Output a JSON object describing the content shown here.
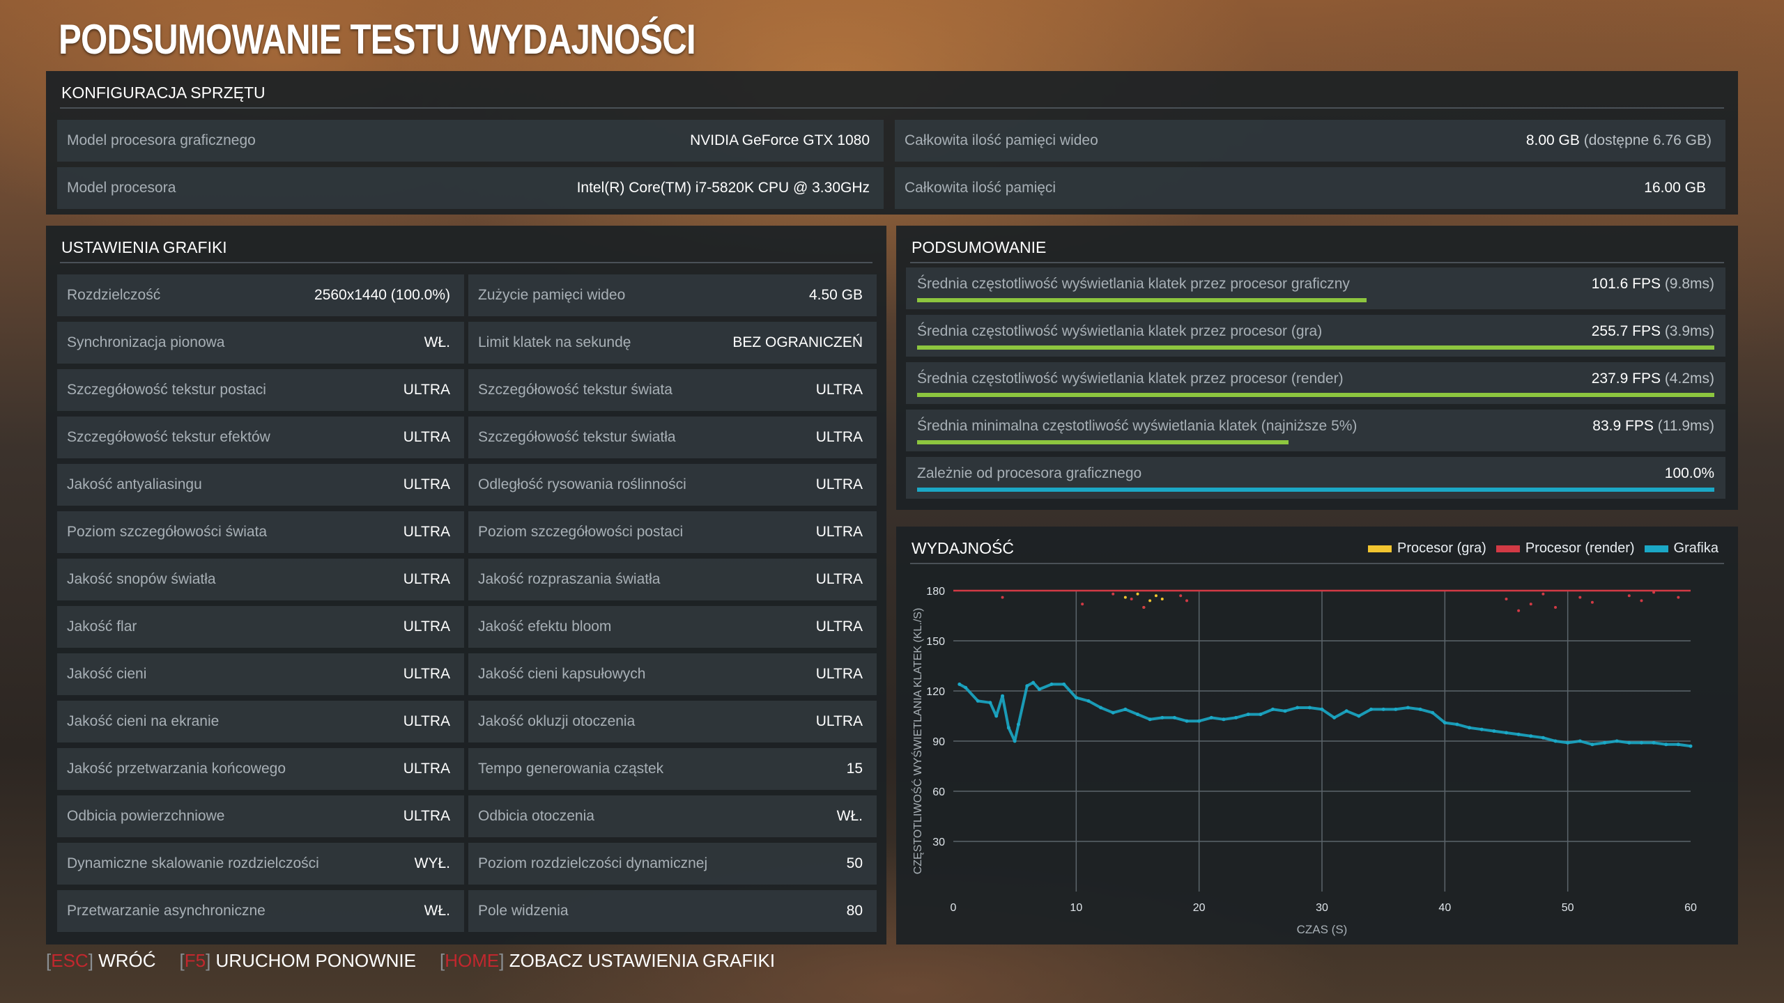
{
  "title": "PODSUMOWANIE TESTU WYDAJNOŚCI",
  "hardware": {
    "header": "KONFIGURACJA SPRZĘTU",
    "gpu_label": "Model procesora graficznego",
    "gpu_value": "NVIDIA GeForce GTX 1080",
    "cpu_label": "Model procesora",
    "cpu_value": "Intel(R) Core(TM) i7-5820K CPU @ 3.30GHz",
    "vram_label": "Całkowita ilość pamięci wideo",
    "vram_value": "8.00 GB",
    "vram_available": "(dostępne 6.76 GB)",
    "ram_label": "Całkowita ilość pamięci",
    "ram_value": "16.00 GB"
  },
  "graphics": {
    "header": "USTAWIENIA GRAFIKI",
    "left": [
      {
        "label": "Rozdzielczość",
        "value": "2560x1440 (100.0%)"
      },
      {
        "label": "Synchronizacja pionowa",
        "value": "WŁ."
      },
      {
        "label": "Szczegółowość tekstur postaci",
        "value": "ULTRA"
      },
      {
        "label": "Szczegółowość tekstur efektów",
        "value": "ULTRA"
      },
      {
        "label": "Jakość antyaliasingu",
        "value": "ULTRA"
      },
      {
        "label": "Poziom szczegółowości świata",
        "value": "ULTRA"
      },
      {
        "label": "Jakość snopów światła",
        "value": "ULTRA"
      },
      {
        "label": "Jakość flar",
        "value": "ULTRA"
      },
      {
        "label": "Jakość cieni",
        "value": "ULTRA"
      },
      {
        "label": "Jakość cieni na ekranie",
        "value": "ULTRA"
      },
      {
        "label": "Jakość przetwarzania końcowego",
        "value": "ULTRA"
      },
      {
        "label": "Odbicia powierzchniowe",
        "value": "ULTRA"
      },
      {
        "label": "Dynamiczne skalowanie rozdzielczości",
        "value": "WYŁ."
      },
      {
        "label": "Przetwarzanie asynchroniczne",
        "value": "WŁ."
      }
    ],
    "right": [
      {
        "label": "Zużycie pamięci wideo",
        "value": "4.50 GB"
      },
      {
        "label": "Limit klatek na sekundę",
        "value": "BEZ OGRANICZEŃ"
      },
      {
        "label": "Szczegółowość tekstur świata",
        "value": "ULTRA"
      },
      {
        "label": "Szczegółowość tekstur światła",
        "value": "ULTRA"
      },
      {
        "label": "Odległość rysowania roślinności",
        "value": "ULTRA"
      },
      {
        "label": "Poziom szczegółowości postaci",
        "value": "ULTRA"
      },
      {
        "label": "Jakość rozpraszania światła",
        "value": "ULTRA"
      },
      {
        "label": "Jakość efektu bloom",
        "value": "ULTRA"
      },
      {
        "label": "Jakość cieni kapsułowych",
        "value": "ULTRA"
      },
      {
        "label": "Jakość okluzji otoczenia",
        "value": "ULTRA"
      },
      {
        "label": "Tempo generowania cząstek",
        "value": "15"
      },
      {
        "label": "Odbicia otoczenia",
        "value": "WŁ."
      },
      {
        "label": "Poziom rozdzielczości dynamicznej",
        "value": "50"
      },
      {
        "label": "Pole widzenia",
        "value": "80"
      }
    ]
  },
  "summary": {
    "header": "PODSUMOWANIE",
    "rows": [
      {
        "label": "Średnia częstotliwość wyświetlania klatek przez procesor graficzny",
        "value": "101.6 FPS",
        "sub": "(9.8ms)",
        "fill": 0.564,
        "color": "#8dc63f"
      },
      {
        "label": "Średnia częstotliwość wyświetlania klatek przez procesor (gra)",
        "value": "255.7 FPS",
        "sub": "(3.9ms)",
        "fill": 1.0,
        "color": "#8dc63f"
      },
      {
        "label": "Średnia częstotliwość wyświetlania klatek przez procesor (render)",
        "value": "237.9 FPS",
        "sub": "(4.2ms)",
        "fill": 1.0,
        "color": "#8dc63f"
      },
      {
        "label": "Średnia minimalna częstotliwość wyświetlania klatek (najniższe 5%)",
        "value": "83.9 FPS",
        "sub": "(11.9ms)",
        "fill": 0.466,
        "color": "#8dc63f"
      },
      {
        "label": "Zależnie od procesora graficznego",
        "value": "100.0%",
        "sub": "",
        "fill": 1.0,
        "color": "#1ba8c6"
      }
    ]
  },
  "performance": {
    "header": "WYDAJNOŚĆ",
    "legend": [
      {
        "name": "Procesor (gra)",
        "color": "#f2c530"
      },
      {
        "name": "Procesor (render)",
        "color": "#d23a45"
      },
      {
        "name": "Grafika",
        "color": "#1ba8c6"
      }
    ]
  },
  "chart_data": {
    "type": "scatter",
    "xlabel": "CZAS (S)",
    "ylabel": "CZĘSTOTLIWOŚĆ WYŚWIETLANIA KLATEK (KL./S)",
    "xlim": [
      0,
      60
    ],
    "ylim": [
      0,
      180
    ],
    "xticks": [
      0,
      10,
      20,
      30,
      40,
      50,
      60
    ],
    "yticks": [
      30,
      60,
      90,
      120,
      150,
      180
    ],
    "grid": true,
    "cap_line": {
      "name": "Procesor (render)",
      "y": 180,
      "color": "#d23a45"
    },
    "series": [
      {
        "name": "Grafika",
        "color": "#1ba8c6",
        "x": [
          0.5,
          1,
          2,
          3,
          3.5,
          4,
          4.5,
          5,
          5.3,
          6,
          6.5,
          7,
          8,
          9,
          10,
          11,
          12,
          13,
          14,
          15,
          16,
          17,
          18,
          19,
          20,
          21,
          22,
          23,
          24,
          25,
          26,
          27,
          28,
          29,
          30,
          31,
          32,
          33,
          34,
          35,
          36,
          37,
          38,
          39,
          40,
          41,
          42,
          43,
          44,
          45,
          46,
          47,
          48,
          49,
          50,
          51,
          52,
          53,
          54,
          55,
          56,
          57,
          58,
          59,
          60
        ],
        "y": [
          124,
          122,
          114,
          113,
          105,
          117,
          98,
          90,
          100,
          123,
          125,
          121,
          124,
          124,
          116,
          114,
          110,
          107,
          109,
          106,
          103,
          104,
          104,
          102,
          102,
          104,
          103,
          104,
          106,
          106,
          109,
          108,
          110,
          110,
          109,
          104,
          108,
          105,
          109,
          109,
          109,
          110,
          109,
          107,
          101,
          100,
          98,
          97,
          96,
          95,
          94,
          93,
          92,
          90,
          89,
          90,
          88,
          89,
          90,
          89,
          89,
          89,
          88,
          88,
          87
        ]
      },
      {
        "name": "Procesor (gra)",
        "color": "#f2c530",
        "x": [
          14,
          15,
          15.5,
          16,
          16.5,
          17
        ],
        "y": [
          176,
          178,
          170,
          174,
          177,
          175
        ]
      },
      {
        "name": "Procesor (render)",
        "color": "#d23a45",
        "x": [
          4,
          10.5,
          13,
          14.5,
          15.5,
          18.5,
          19,
          45,
          46,
          47,
          48,
          49,
          51,
          52,
          55,
          56,
          57,
          59
        ],
        "y": [
          176,
          172,
          178,
          175,
          170,
          177,
          174,
          175,
          168,
          172,
          178,
          170,
          176,
          173,
          177,
          174,
          179,
          176
        ]
      }
    ]
  },
  "footer": [
    {
      "key": "ESC",
      "action": "WRÓĆ"
    },
    {
      "key": "F5",
      "action": "URUCHOM PONOWNIE"
    },
    {
      "key": "HOME",
      "action": "ZOBACZ USTAWIENIA GRAFIKI"
    }
  ]
}
